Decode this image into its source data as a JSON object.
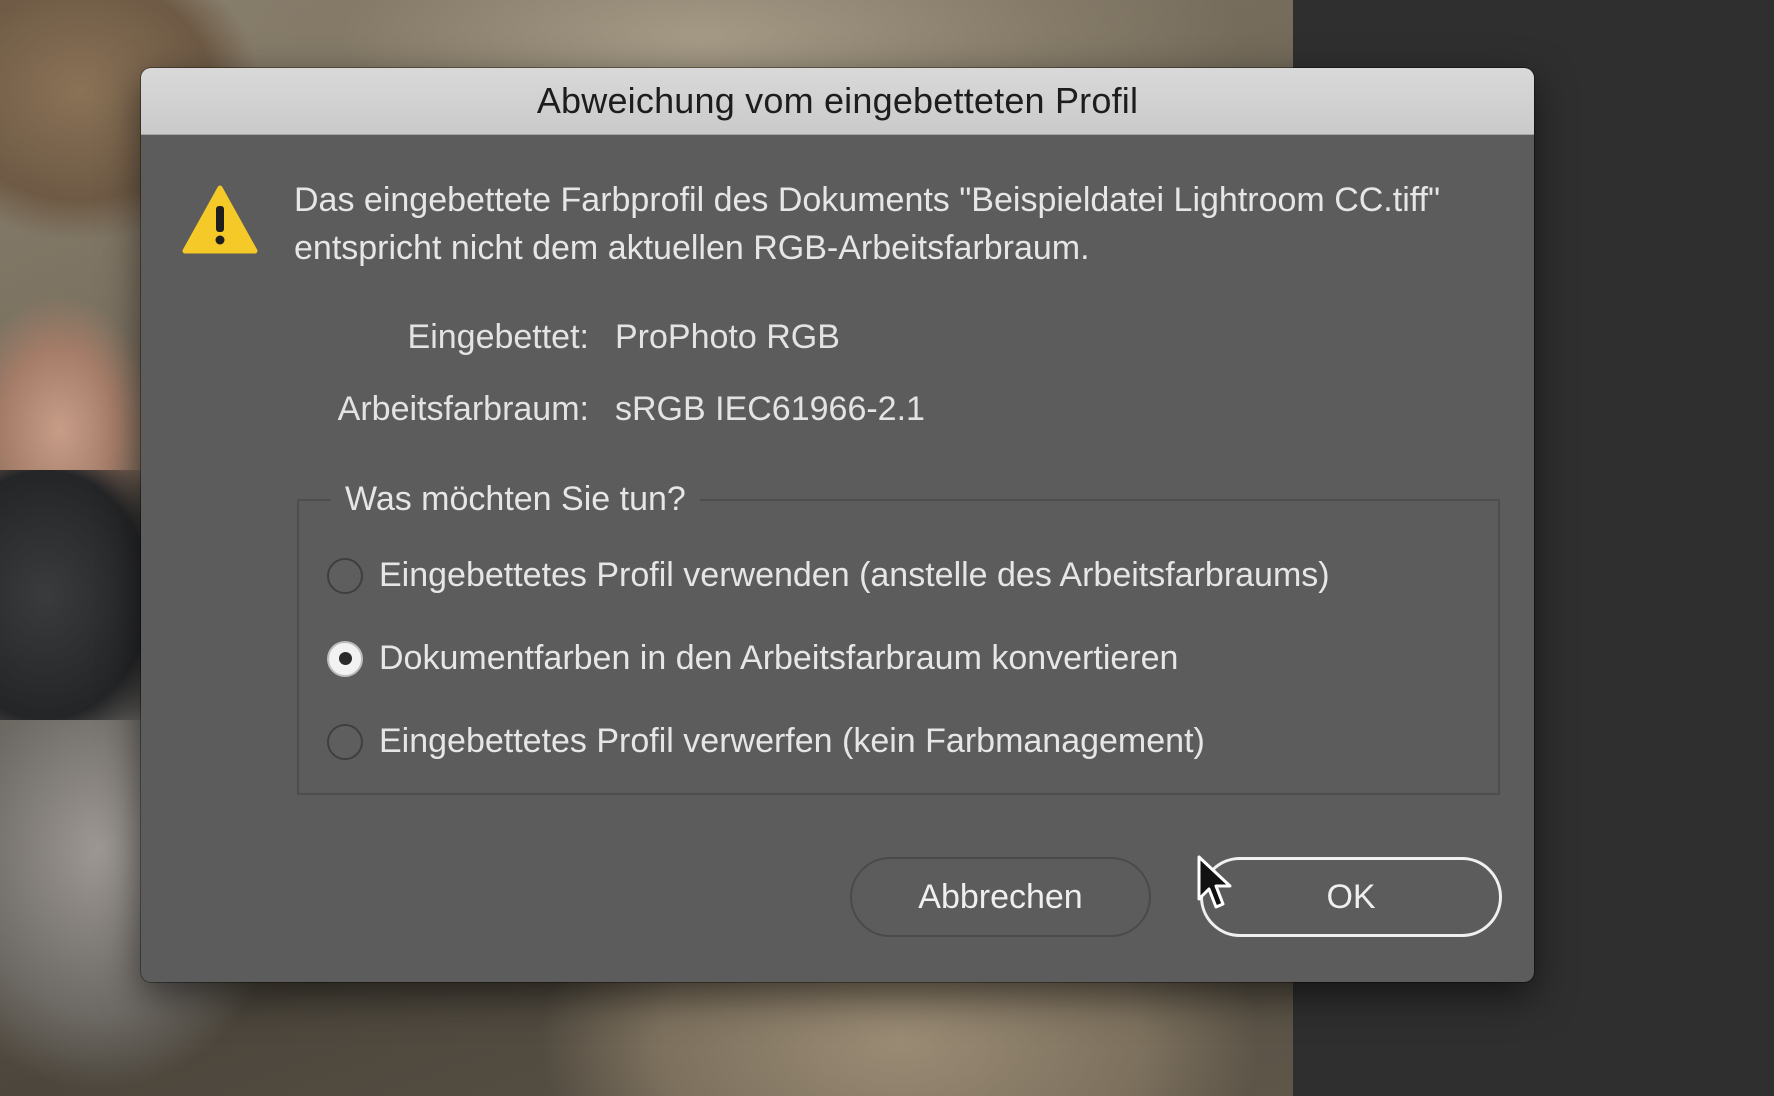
{
  "dialog": {
    "title": "Abweichung vom eingebetteten Profil",
    "warning_icon": "warning-triangle-icon",
    "message": "Das eingebettete Farbprofil des Dokuments \"Beispieldatei Lightroom CC.tiff\" entspricht nicht dem aktuellen RGB-Arbeitsfarbraum.",
    "embedded": {
      "label": "Eingebettet:",
      "value": "ProPhoto RGB"
    },
    "working_space": {
      "label": "Arbeitsfarbraum:",
      "value": "sRGB IEC61966-2.1"
    },
    "group": {
      "legend": "Was möchten Sie tun?",
      "options": [
        {
          "label": "Eingebettetes Profil verwenden (anstelle des Arbeitsfarbraums)",
          "selected": false
        },
        {
          "label": "Dokumentfarben in den Arbeitsfarbraum konvertieren",
          "selected": true
        },
        {
          "label": "Eingebettetes Profil verwerfen (kein Farbmanagement)",
          "selected": false
        }
      ]
    },
    "buttons": {
      "cancel": "Abbrechen",
      "ok": "OK"
    }
  },
  "colors": {
    "dialog_background": "#5c5c5c",
    "titlebar": "#d0d0d0",
    "warning_yellow": "#f5c928",
    "text": "#e6e6e6"
  }
}
